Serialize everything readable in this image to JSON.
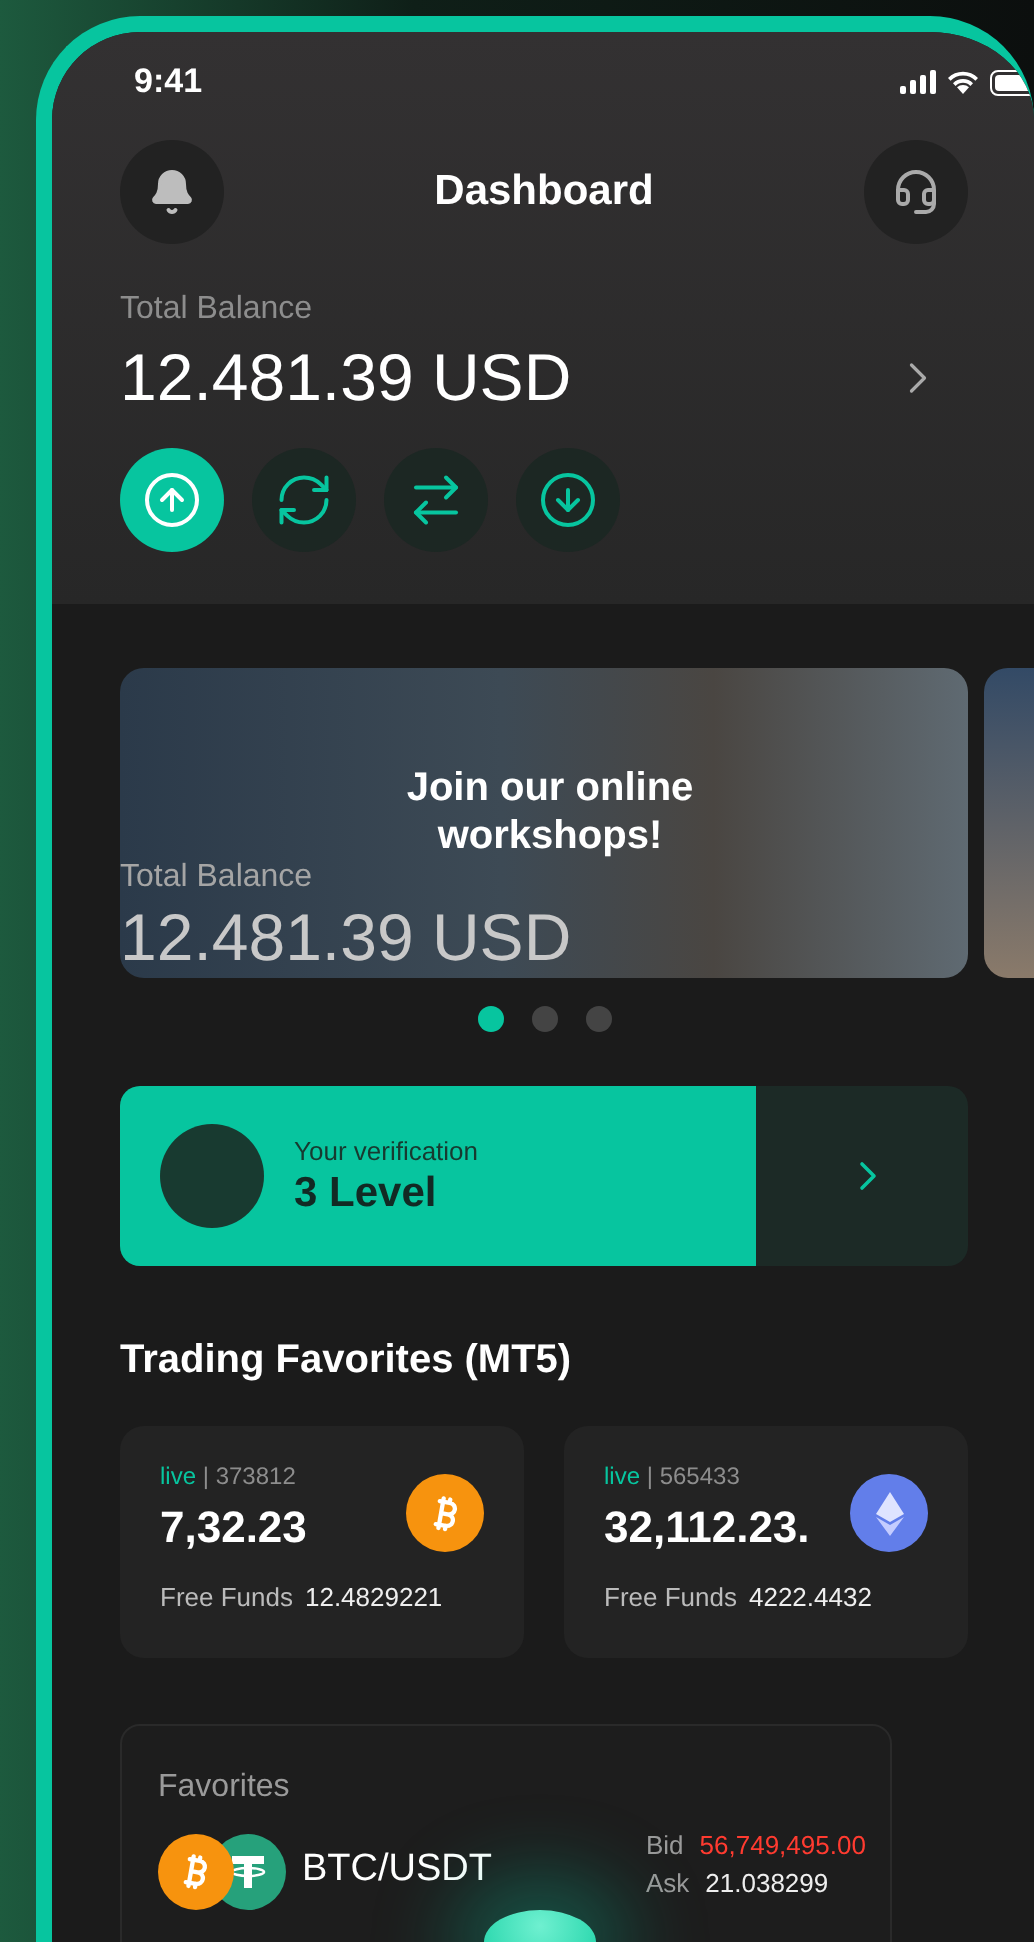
{
  "status_bar": {
    "time": "9:41"
  },
  "header": {
    "title": "Dashboard"
  },
  "balance": {
    "label": "Total Balance",
    "amount": "12.481.39 USD"
  },
  "actions": [
    {
      "kind": "send",
      "selected": true
    },
    {
      "kind": "exchange",
      "selected": false
    },
    {
      "kind": "transfer",
      "selected": false
    },
    {
      "kind": "receive",
      "selected": false
    }
  ],
  "banner": {
    "title": "Join our online workshops!",
    "ghost_label": "Total Balance",
    "ghost_amount": "12.481.39 USD"
  },
  "carousel_dots": [
    {
      "selected": true
    },
    {
      "selected": false
    },
    {
      "selected": false
    }
  ],
  "verification": {
    "caption": "Your verification",
    "value": "3 Level",
    "level": 0.75
  },
  "trading": {
    "title": "Trading Favorites (MT5)",
    "accounts": [
      {
        "status": "live",
        "separator": "|",
        "number": "373812",
        "amount": "7,32.23",
        "funds_label": "Free Funds",
        "funds": "12.4829221",
        "kind": "bitcoin"
      },
      {
        "status": "live",
        "separator": "|",
        "number": "565433",
        "amount": "32,112.23.",
        "funds_label": "Free Funds",
        "funds": "4222.4432",
        "kind": "ethereum"
      }
    ]
  },
  "favorites": {
    "title": "Favorites",
    "pairs": [
      {
        "name": "BTC/USDT",
        "bid_label": "Bid",
        "bid": "56,749,495.00",
        "ask_label": "Ask",
        "ask": "21.038299"
      }
    ]
  }
}
